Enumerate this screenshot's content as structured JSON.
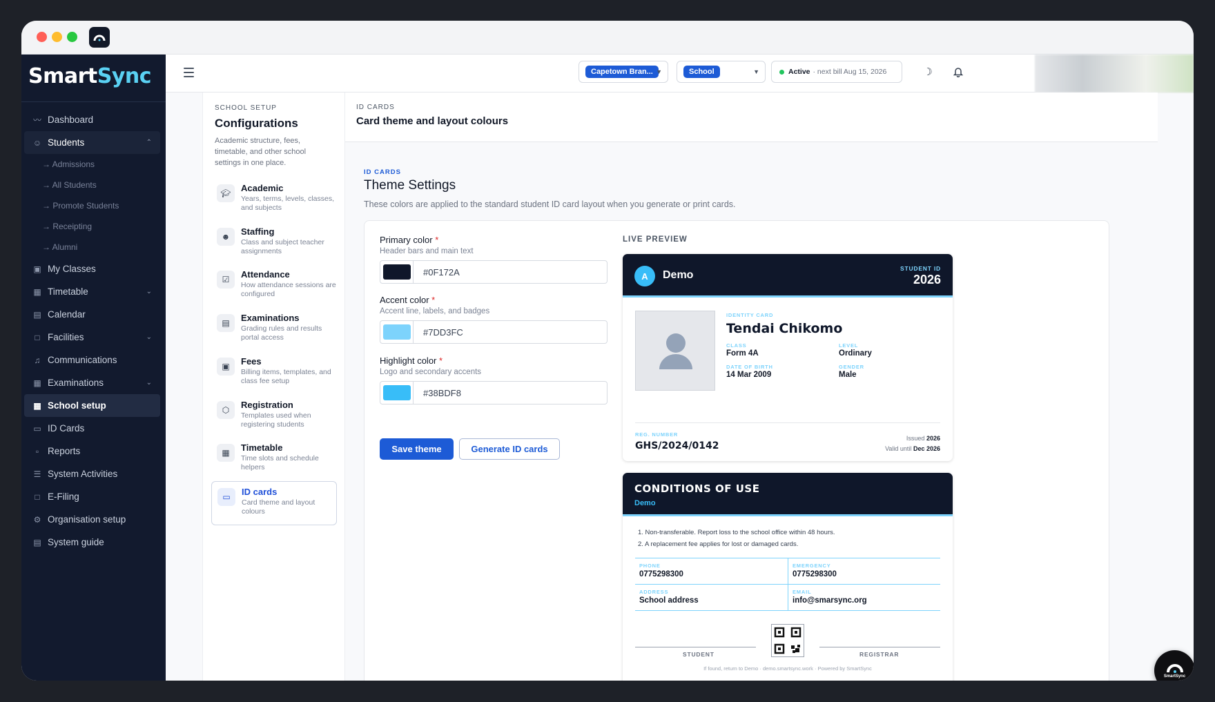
{
  "brand": {
    "name_part1": "Smart",
    "name_part2": "Sync"
  },
  "sidebar": {
    "items": [
      {
        "label": "Dashboard",
        "icon": "dashboard-icon"
      },
      {
        "label": "Students",
        "icon": "user-icon",
        "expanded": true
      },
      {
        "label": "My Classes",
        "icon": "classes-icon"
      },
      {
        "label": "Timetable",
        "icon": "timetable-icon",
        "has_children": true
      },
      {
        "label": "Calendar",
        "icon": "calendar-icon"
      },
      {
        "label": "Facilities",
        "icon": "building-icon",
        "has_children": true
      },
      {
        "label": "Communications",
        "icon": "bell-icon"
      },
      {
        "label": "Examinations",
        "icon": "table-icon",
        "has_children": true
      },
      {
        "label": "School setup",
        "icon": "grid-icon",
        "active": true
      },
      {
        "label": "ID Cards",
        "icon": "id-card-icon"
      },
      {
        "label": "Reports",
        "icon": "pdf-icon"
      },
      {
        "label": "System Activities",
        "icon": "list-icon"
      },
      {
        "label": "E-Filing",
        "icon": "file-icon"
      },
      {
        "label": "Organisation setup",
        "icon": "gear-icon"
      },
      {
        "label": "System guide",
        "icon": "book-icon"
      }
    ],
    "students_sub": [
      "→ Admissions",
      "→ All Students",
      "→ Promote Students",
      "→ Receipting",
      "→ Alumni"
    ]
  },
  "topbar": {
    "branch_value": "Capetown Bran...",
    "type_value": "School",
    "status_active": "Active",
    "status_text": "· next bill Aug 15, 2026"
  },
  "config": {
    "kicker": "SCHOOL SETUP",
    "title": "Configurations",
    "description": "Academic structure, fees, timetable, and other school settings in one place.",
    "items": [
      {
        "title": "Academic",
        "desc": "Years, terms, levels, classes, and subjects",
        "icon": "graduation-cap-icon"
      },
      {
        "title": "Staffing",
        "desc": "Class and subject teacher assignments",
        "icon": "users-icon"
      },
      {
        "title": "Attendance",
        "desc": "How attendance sessions are configured",
        "icon": "clipboard-icon"
      },
      {
        "title": "Examinations",
        "desc": "Grading rules and results portal access",
        "icon": "document-icon"
      },
      {
        "title": "Fees",
        "desc": "Billing items, templates, and class fee setup",
        "icon": "wallet-icon"
      },
      {
        "title": "Registration",
        "desc": "Templates used when registering students",
        "icon": "box-icon"
      },
      {
        "title": "Timetable",
        "desc": "Time slots and schedule helpers",
        "icon": "calendar-icon"
      },
      {
        "title": "ID cards",
        "desc": "Card theme and layout colours",
        "icon": "id-card-icon",
        "active": true
      }
    ]
  },
  "main": {
    "kicker": "ID CARDS",
    "title": "Card theme and layout colours",
    "section_kicker": "ID CARDS",
    "section_title": "Theme Settings",
    "section_desc": "These colors are applied to the standard student ID card layout when you generate or print cards.",
    "fields": [
      {
        "label": "Primary color",
        "hint": "Header bars and main text",
        "value": "#0F172A",
        "swatch": "#0f172a"
      },
      {
        "label": "Accent color",
        "hint": "Accent line, labels, and badges",
        "value": "#7DD3FC",
        "swatch": "#7dd3fc"
      },
      {
        "label": "Highlight color",
        "hint": "Logo and secondary accents",
        "value": "#38BDF8",
        "swatch": "#38bdf8"
      }
    ],
    "save_label": "Save theme",
    "generate_label": "Generate ID cards",
    "preview_label": "LIVE PREVIEW"
  },
  "id_card": {
    "logo_letter": "A",
    "school": "Demo",
    "student_id_label": "STUDENT ID",
    "student_id": "2026",
    "identity_label": "IDENTITY CARD",
    "name": "Tendai Chikomo",
    "class_label": "CLASS",
    "class_value": "Form 4A",
    "level_label": "LEVEL",
    "level_value": "Ordinary",
    "dob_label": "DATE OF BIRTH",
    "dob_value": "14 Mar 2009",
    "gender_label": "GENDER",
    "gender_value": "Male",
    "reg_label": "REG. NUMBER",
    "reg_value": "GHS/2024/0142",
    "issued_label": "Issued",
    "issued_value": "2026",
    "valid_label": "Valid until",
    "valid_value": "Dec 2026"
  },
  "conditions": {
    "title": "CONDITIONS OF USE",
    "subtitle": "Demo",
    "rules": [
      "1. Non-transferable. Report loss to the school office within 48 hours.",
      "2. A replacement fee applies for lost or damaged cards."
    ],
    "phone_label": "PHONE",
    "phone_value": "0775298300",
    "emergency_label": "EMERGENCY",
    "emergency_value": "0775298300",
    "address_label": "ADDRESS",
    "address_value": "School address",
    "email_label": "EMAIL",
    "email_value": "info@smarsync.org",
    "student_sig": "STUDENT",
    "registrar_sig": "REGISTRAR",
    "footer": "If found, return to Demo · demo.smartsync.work · Powered by SmartSync"
  },
  "fab_label": "SmartSync",
  "colors": {
    "brand_blue": "#1d5bd6",
    "sidebar_bg": "#121a2e",
    "primary": "#0f172a",
    "accent": "#7dd3fc",
    "highlight": "#38bdf8"
  }
}
